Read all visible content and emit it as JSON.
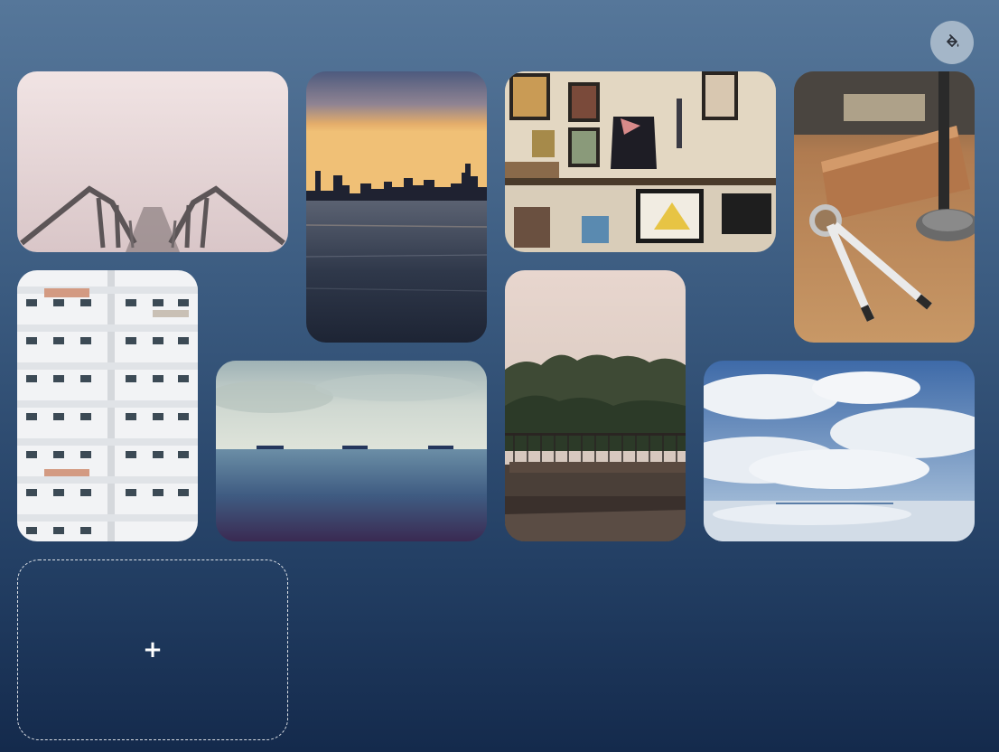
{
  "toolbar": {
    "theme_icon": "paint-bucket-icon"
  },
  "gallery": {
    "photos": [
      {
        "subject": "pier-in-fog"
      },
      {
        "subject": "city-skyline-at-sunset-over-water"
      },
      {
        "subject": "wall-with-framed-pictures-and-jacket"
      },
      {
        "subject": "compass-and-leather-notebook-on-desk"
      },
      {
        "subject": "white-apartment-building"
      },
      {
        "subject": "ships-on-sea-horizon"
      },
      {
        "subject": "misty-forest-with-railing"
      },
      {
        "subject": "clouds-reflected-on-water"
      }
    ],
    "add_tile": {
      "label": "+"
    }
  },
  "colors": {
    "background_top": "#56779a",
    "background_bottom": "#142a4c",
    "theme_button": "#a4b6c8"
  }
}
